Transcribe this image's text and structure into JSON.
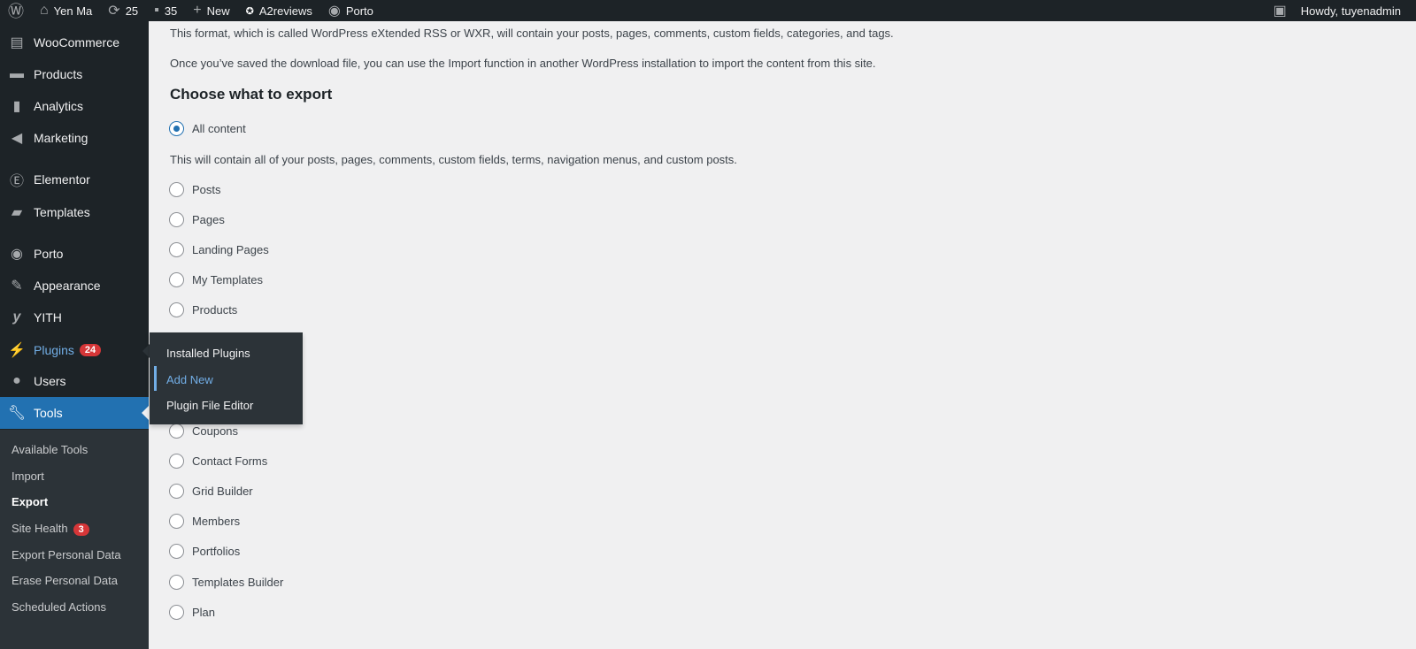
{
  "adminbar": {
    "site": "Yen Ma",
    "updates": "25",
    "comments": "35",
    "new": "New",
    "a2": "A2reviews",
    "porto": "Porto",
    "howdy": "Howdy, tuyenadmin"
  },
  "menu": [
    {
      "label": "WooCommerce",
      "icon": "woo-icon"
    },
    {
      "label": "Products",
      "icon": "archive-icon"
    },
    {
      "label": "Analytics",
      "icon": "chart-icon"
    },
    {
      "label": "Marketing",
      "icon": "megaphone-icon"
    },
    {
      "label": "Elementor",
      "icon": "elementor-icon"
    },
    {
      "label": "Templates",
      "icon": "folder-icon"
    },
    {
      "label": "Porto",
      "icon": "porto-icon"
    },
    {
      "label": "Appearance",
      "icon": "brush-icon"
    },
    {
      "label": "YITH",
      "icon": "yith-icon"
    },
    {
      "label": "Plugins",
      "icon": "plugin-icon",
      "badge": "24"
    },
    {
      "label": "Users",
      "icon": "user-icon"
    },
    {
      "label": "Tools",
      "icon": "wrench-icon"
    }
  ],
  "submenu": [
    {
      "label": "Available Tools"
    },
    {
      "label": "Import"
    },
    {
      "label": "Export"
    },
    {
      "label": "Site Health",
      "badge": "3"
    },
    {
      "label": "Export Personal Data"
    },
    {
      "label": "Erase Personal Data"
    },
    {
      "label": "Scheduled Actions"
    }
  ],
  "flyout": [
    "Installed Plugins",
    "Add New",
    "Plugin File Editor"
  ],
  "content": {
    "p1": "This format, which is called WordPress eXtended RSS or WXR, will contain your posts, pages, comments, custom fields, categories, and tags.",
    "p2": "Once you’ve saved the download file, you can use the Import function in another WordPress installation to import the content from this site.",
    "heading": "Choose what to export",
    "all": "All content",
    "all_desc": "This will contain all of your posts, pages, comments, custom fields, terms, navigation menus, and custom posts.",
    "options": [
      "Posts",
      "Pages",
      "Landing Pages",
      "My Templates",
      "Products"
    ],
    "options2": [
      "Coupons",
      "Contact Forms",
      "Grid Builder",
      "Members",
      "Portfolios",
      "Templates Builder",
      "Plan"
    ]
  }
}
